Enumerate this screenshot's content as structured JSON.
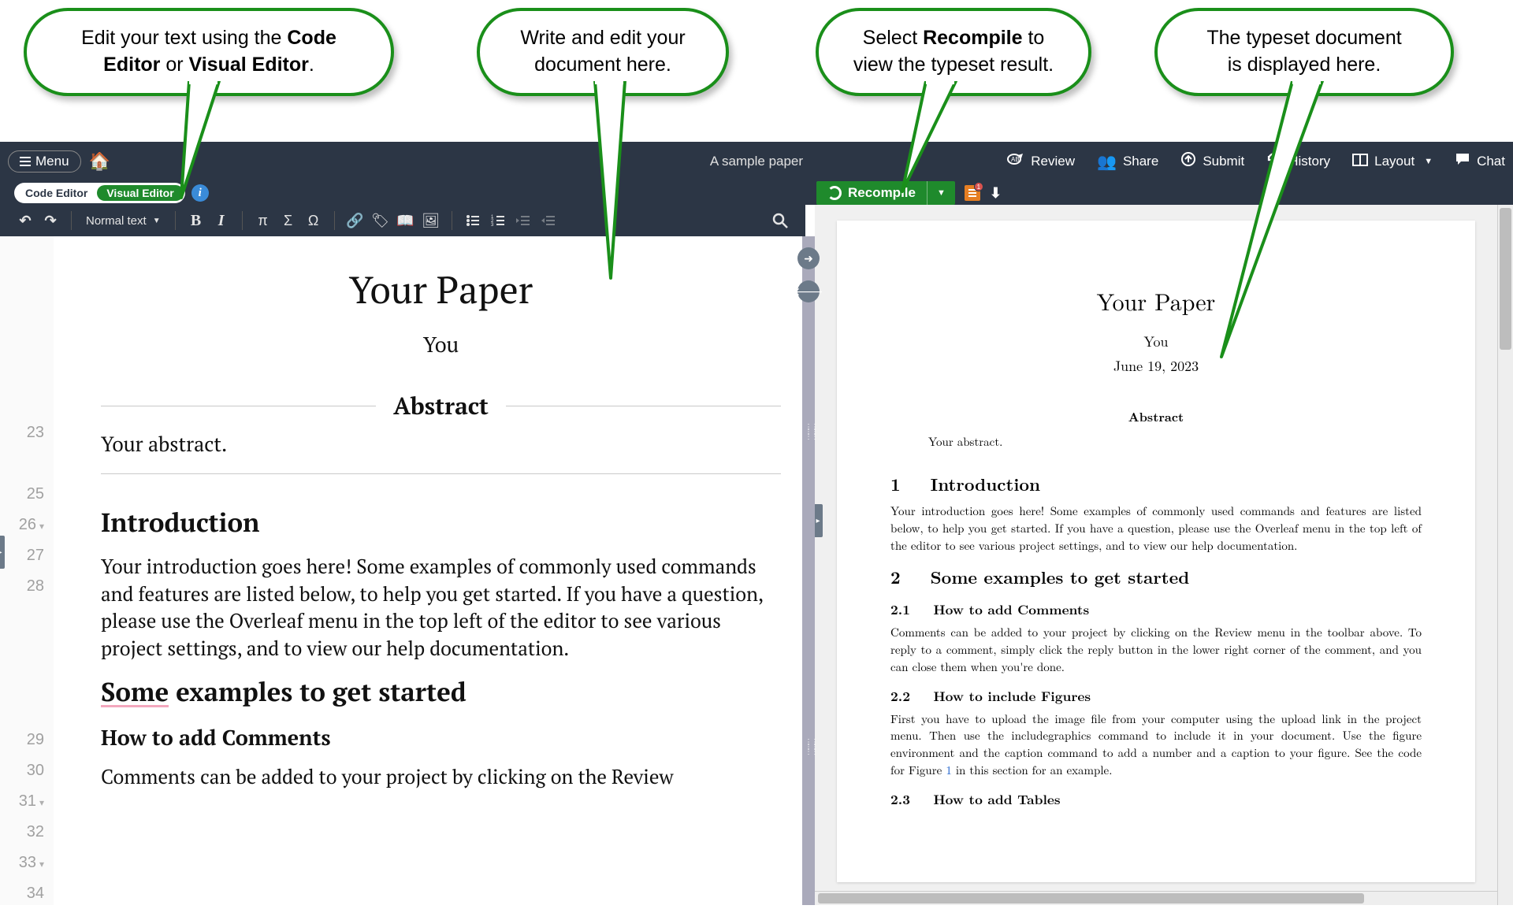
{
  "callouts": {
    "c1a": "Edit your text using the ",
    "c1b": "Code Editor",
    "c1c": " or ",
    "c1d": "Visual Editor",
    "c1e": ".",
    "c2a": "Write and edit your",
    "c2b": "document here.",
    "c3a": "Select ",
    "c3b": "Recompile",
    "c3c": " to",
    "c3d": "view the typeset result.",
    "c4a": "The typeset document",
    "c4b": "is displayed here."
  },
  "navbar": {
    "menu": "Menu",
    "title": "A sample paper",
    "review": "Review",
    "share": "Share",
    "submit": "Submit",
    "history": "History",
    "layout": "Layout",
    "chat": "Chat"
  },
  "switch": {
    "code": "Code Editor",
    "visual": "Visual Editor"
  },
  "recompile": {
    "label": "Recompile",
    "logs_count": "1"
  },
  "fmtbar": {
    "paragraph": "Normal text"
  },
  "gutter": {
    "lines": [
      "23",
      "",
      "25",
      "26",
      "27",
      "28",
      "",
      "",
      "",
      "",
      "29",
      "30",
      "31",
      "32",
      "33",
      "34"
    ],
    "folds": {
      "3": "▾",
      "12": "▾",
      "14": "▾"
    }
  },
  "doc": {
    "title": "Your Paper",
    "author": "You",
    "abstract_label": "Abstract",
    "abstract_text": "Your abstract.",
    "h_intro": "Introduction",
    "p_intro": "Your introduction goes here! Some examples of commonly used commands and features are listed below, to help you get started. If you have a question, please use the Overleaf menu in the top left of the editor to see various project settings, and to view our help documentation.",
    "h_some_pre": "Some",
    "h_some_post": " examples to get started",
    "h_comments": "How to add Comments",
    "p_comments": "Comments can be added to your project by clicking on the Review"
  },
  "preview": {
    "title": "Your Paper",
    "author": "You",
    "date": "June 19, 2023",
    "abstract_label": "Abstract",
    "abstract_text": "Your abstract.",
    "sec1_num": "1",
    "sec1": "Introduction",
    "p1": "Your introduction goes here! Some examples of commonly used commands and features are listed below, to help you get started. If you have a question, please use the Overleaf menu in the top left of the editor to see various project settings, and to view our help documentation.",
    "sec2_num": "2",
    "sec2": "Some examples to get started",
    "sub21_num": "2.1",
    "sub21": "How to add Comments",
    "p21": "Comments can be added to your project by clicking on the Review menu in the toolbar above. To reply to a comment, simply click the reply button in the lower right corner of the comment, and you can close them when you're done.",
    "sub22_num": "2.2",
    "sub22": "How to include Figures",
    "p22a": "First you have to upload the image file from your computer using the upload link in the project menu. Then use the includegraphics command to include it in your document. Use the figure environment and the caption command to add a number and a caption to your figure. See the code for Figure ",
    "p22ref": "1",
    "p22b": " in this section for an example.",
    "sub23_num": "2.3",
    "sub23": "How to add Tables"
  }
}
